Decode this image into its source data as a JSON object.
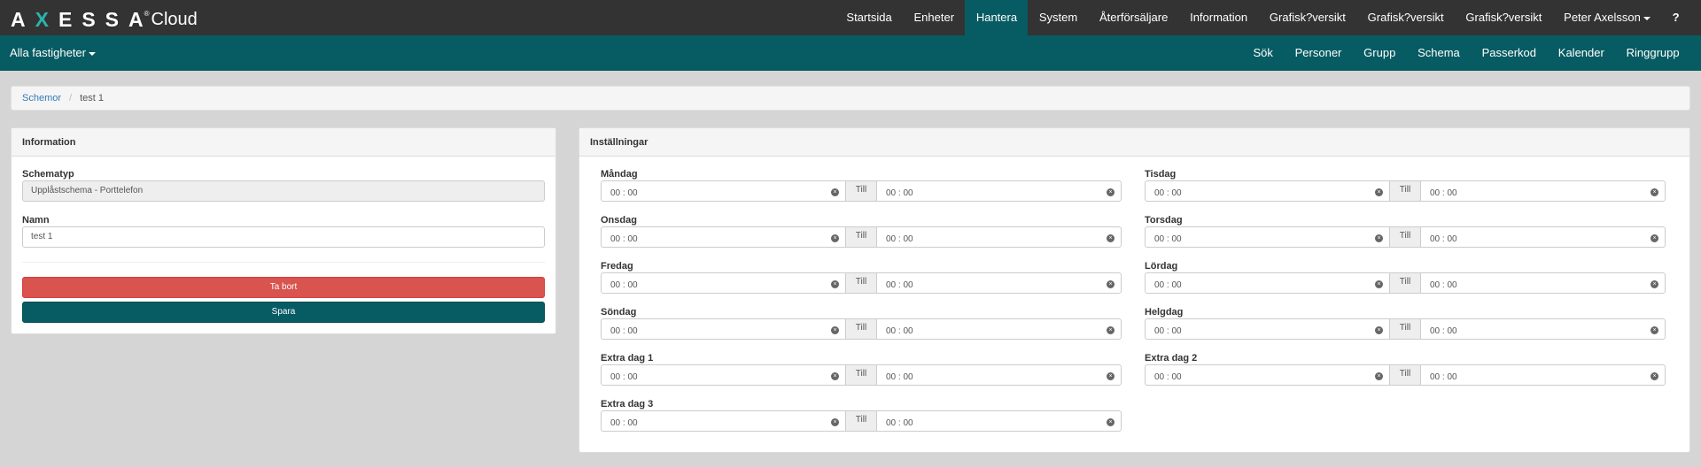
{
  "brand": {
    "logo_text": "AXESSA",
    "logo_sup": "®",
    "logo_cloud": "Cloud"
  },
  "topnav": [
    {
      "label": "Startsida"
    },
    {
      "label": "Enheter"
    },
    {
      "label": "Hantera"
    },
    {
      "label": "System"
    },
    {
      "label": "Återförsäljare"
    },
    {
      "label": "Information"
    },
    {
      "label": "Grafisk?versikt"
    },
    {
      "label": "Grafisk?versikt"
    },
    {
      "label": "Grafisk?versikt"
    },
    {
      "label": "Peter Axelsson"
    },
    {
      "label": "?"
    }
  ],
  "topnav_active": "Hantera",
  "subbar": {
    "property_select": "Alla fastigheter",
    "items": [
      {
        "label": "Sök"
      },
      {
        "label": "Personer"
      },
      {
        "label": "Grupp"
      },
      {
        "label": "Schema"
      },
      {
        "label": "Passerkod"
      },
      {
        "label": "Kalender"
      },
      {
        "label": "Ringgrupp"
      }
    ]
  },
  "breadcrumb": {
    "link": "Schemor",
    "separator": "/",
    "current": "test 1"
  },
  "info_panel": {
    "title": "Information",
    "schematyp_label": "Schematyp",
    "schematyp_value": "Upplåstschema - Porttelefon",
    "namn_label": "Namn",
    "namn_value": "test 1",
    "delete_label": "Ta bort",
    "save_label": "Spara"
  },
  "settings_panel": {
    "title": "Inställningar",
    "till_label": "Till",
    "clear_symbol": "×",
    "days": [
      {
        "name": "Måndag",
        "from": "00 : 00",
        "to": "00 : 00"
      },
      {
        "name": "Tisdag",
        "from": "00 : 00",
        "to": "00 : 00"
      },
      {
        "name": "Onsdag",
        "from": "00 : 00",
        "to": "00 : 00"
      },
      {
        "name": "Torsdag",
        "from": "00 : 00",
        "to": "00 : 00"
      },
      {
        "name": "Fredag",
        "from": "00 : 00",
        "to": "00 : 00"
      },
      {
        "name": "Lördag",
        "from": "00 : 00",
        "to": "00 : 00"
      },
      {
        "name": "Söndag",
        "from": "00 : 00",
        "to": "00 : 00"
      },
      {
        "name": "Helgdag",
        "from": "00 : 00",
        "to": "00 : 00"
      },
      {
        "name": "Extra dag 1",
        "from": "00 : 00",
        "to": "00 : 00"
      },
      {
        "name": "Extra dag 2",
        "from": "00 : 00",
        "to": "00 : 00"
      },
      {
        "name": "Extra dag 3",
        "from": "00 : 00",
        "to": "00 : 00"
      }
    ]
  },
  "colors": {
    "topbar": "#333333",
    "accent": "#075b62",
    "danger": "#d9534f",
    "logo_x": "#2bb3ae"
  }
}
